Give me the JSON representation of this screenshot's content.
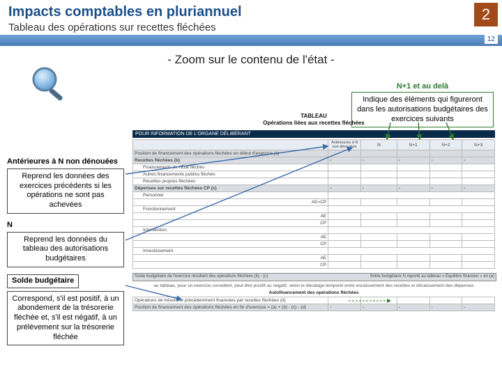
{
  "header": {
    "title": "Impacts comptables en pluriannuel",
    "subtitle": "Tableau des opérations sur recettes fléchées",
    "badge": "2",
    "page_num": "12"
  },
  "zoom_title": "- Zoom sur le contenu de l'état -",
  "n1": {
    "heading": "N+1 et au delà",
    "text": "Indique des éléments qui figureront dans les autorisations budgétaires des exercices suivants"
  },
  "left": {
    "ant_head": "Antérieures à N non dénouées",
    "ant_text": "Reprend les données des exercices précédents si les opérations ne sont pas achevées",
    "n_head": "N",
    "n_text": "Reprend les données du tableau des autorisations budgétaires",
    "solde_head": "Solde budgétaire",
    "solde_text": "Correspond, s'il est positif, à un abondement de la trésorerie fléchée et, s'il est négatif, à un prélèvement sur la trésorerie fléchée"
  },
  "table": {
    "overtitle1": "TABLEAU",
    "overtitle2": "Opérations liées aux recettes fléchées",
    "band": "POUR INFORMATION DE L'ORGANE DÉLIBÉRANT",
    "cols": {
      "r0": "",
      "ant": "Antérieures à N non dénouées",
      "n": "N",
      "n1": "N+1",
      "n2": "N+2",
      "n3": "N+3"
    },
    "rows": {
      "r1": "Position de financement des opérations fléchées en début d'exercice (a)",
      "r2": "Recettes fléchées (b)",
      "r3": "Financements de l'État fléchés",
      "r4": "Autres financements publics fléchés",
      "r5": "Recettes propres fléchées",
      "r6": "Dépenses sur recettes fléchées CP (c)",
      "r7": "Personnel",
      "r7a": "AE=CP",
      "r8": "Fonctionnement",
      "r8a": "AE",
      "r8b": "CP",
      "r9": "Intervention",
      "r10": "Investissement"
    },
    "solde_left": "Solde budgétaire de l'exercice résultant des opérations fléchées (b) - (c)",
    "solde_right_a": "Solde budgétaire N reporté au tableau « Équilibre financier » en (a)",
    "note": "au tableau, pour un exercice considéré, peut être positif ou négatif, selon le décalage temporel entre encaissement des recettes et décaissement des dépenses",
    "sec2_title": "Autofinancement des opérations fléchées",
    "sec2_r1": "Opérations de trésorerie précédemment financées par recettes fléchées (d)",
    "sec2_r2": "Position de financement des opérations fléchées en fin d'exercice = (a) + (b) - (c) - (d)"
  }
}
